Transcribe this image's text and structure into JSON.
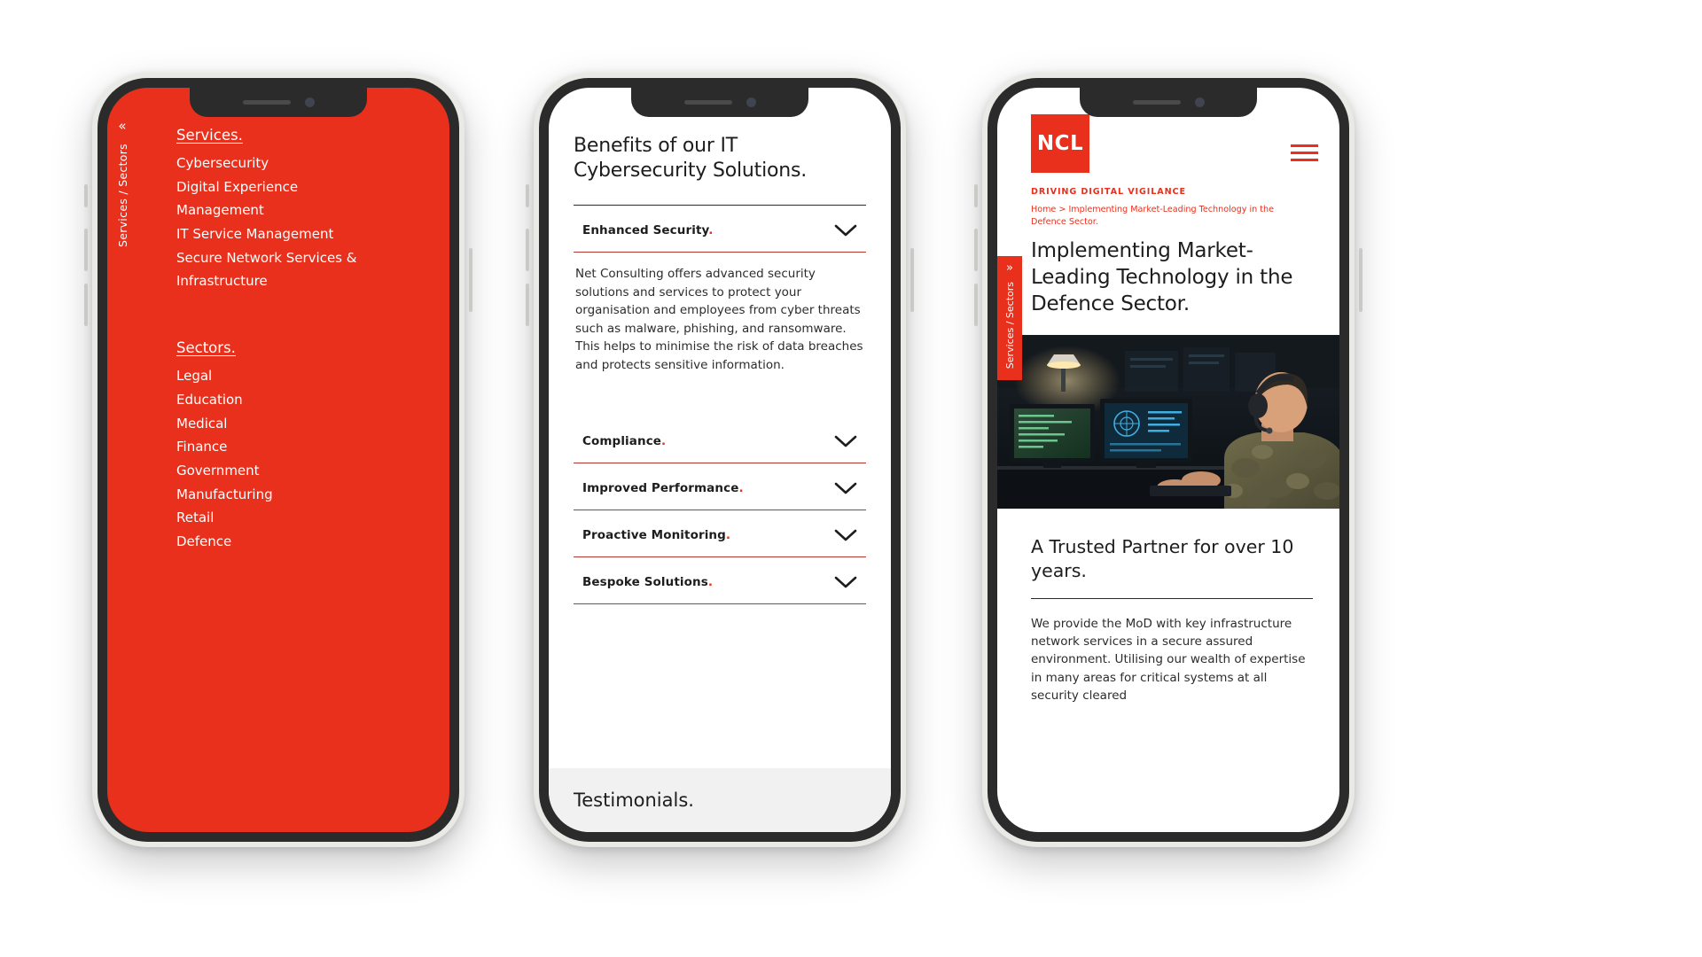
{
  "phone1": {
    "name": "services-sectors-menu",
    "side_tab": {
      "chevron": "«",
      "label": "Services / Sectors"
    },
    "groups": [
      {
        "heading": "Services.",
        "links": [
          "Cybersecurity",
          "Digital Experience",
          "Management",
          "IT Service Management",
          "Secure Network Services &",
          "Infrastructure"
        ]
      },
      {
        "heading": "Sectors.",
        "links": [
          "Legal",
          "Education",
          "Medical",
          "Finance",
          "Government",
          "Manufacturing",
          "Retail",
          "Defence"
        ]
      }
    ]
  },
  "phone2": {
    "name": "benefits-accordion-page",
    "title": "Benefits of our IT Cybersecurity Solutions.",
    "accordion": [
      {
        "label": "Enhanced Security",
        "dot": ".",
        "expanded": true,
        "body": "Net Consulting offers advanced security solutions and services to protect your organisation and employees from cyber threats such as malware, phishing, and ransomware. This helps to minimise the risk of data breaches and protects sensitive information."
      },
      {
        "label": "Compliance",
        "dot": ".",
        "expanded": false,
        "body": ""
      },
      {
        "label": "Improved Performance",
        "dot": ".",
        "expanded": false,
        "body": ""
      },
      {
        "label": "Proactive Monitoring",
        "dot": ".",
        "expanded": false,
        "body": ""
      },
      {
        "label": "Bespoke Solutions",
        "dot": ".",
        "expanded": false,
        "body": ""
      }
    ],
    "footer_heading": "Testimonials."
  },
  "phone3": {
    "name": "defence-case-study-page",
    "logo_text": "NCL",
    "tagline": "DRIVING DIGITAL VIGILANCE",
    "breadcrumb": "Home > Implementing Market-Leading Technology in the Defence Sector.",
    "article_title": "Implementing Market-Leading Technology in the Defence Sector.",
    "side_tab": {
      "chevron": "»",
      "label": "Services / Sectors"
    },
    "hero_alt": "military-operator-at-monitors-photo",
    "section_heading": "A Trusted Partner for over 10 years.",
    "section_body": "We provide the MoD with key infrastructure network services in a secure assured environment. Utilising our wealth of expertise in many areas for critical systems at all security cleared"
  },
  "colors": {
    "brand_red": "#E8301C",
    "rule_red": "#B3372F",
    "text_dark": "#1D1D1D"
  },
  "icons": {
    "chevron_down": "chevron-down-icon",
    "hamburger": "hamburger-menu-icon",
    "chevron_left": "chevron-left-icon",
    "chevron_right": "chevron-right-icon"
  }
}
